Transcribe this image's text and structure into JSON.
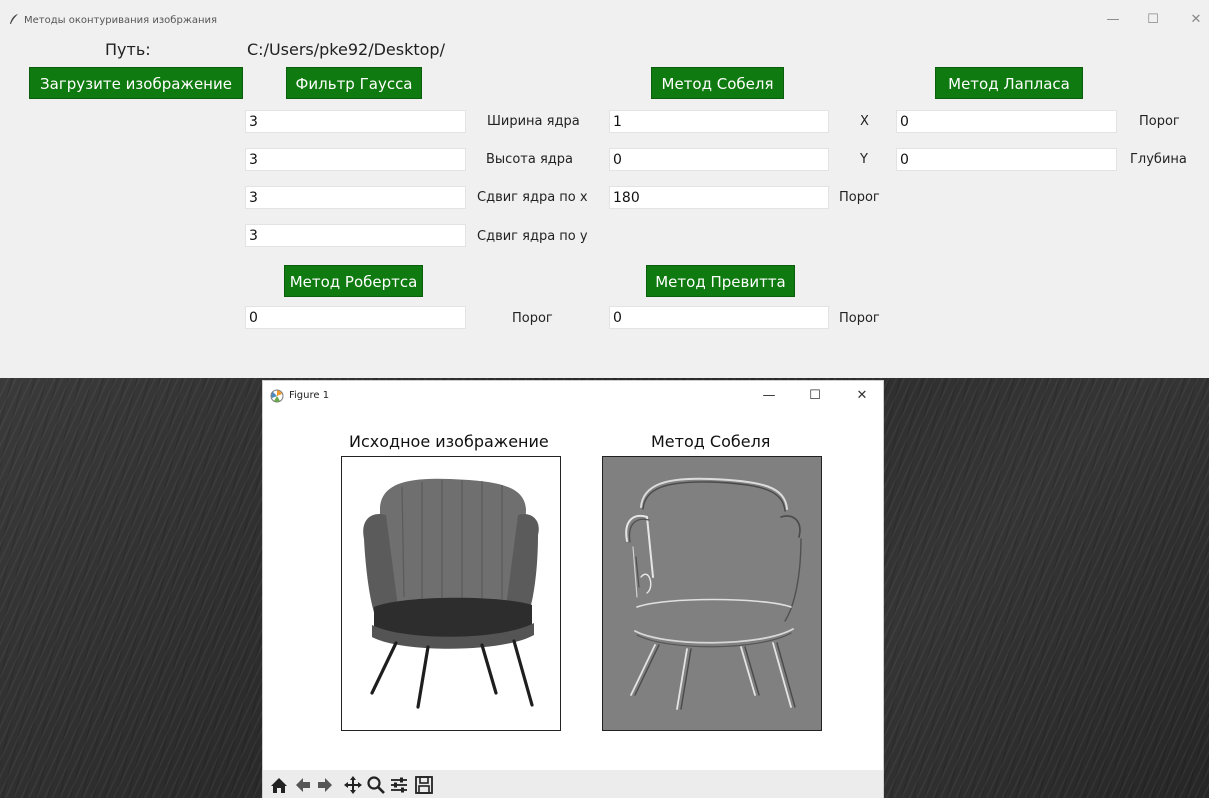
{
  "window": {
    "title": "Методы оконтуривания изобржания",
    "minimize": "—",
    "maximize": "☐",
    "close": "✕"
  },
  "path": {
    "label": "Путь:",
    "value": "C:/Users/pke92/Desktop/"
  },
  "buttons": {
    "load": "Загрузите изображение",
    "gauss": "Фильтр Гаусса",
    "sobel": "Метод Собеля",
    "laplace": "Метод Лапласа",
    "roberts": "Метод Робертса",
    "prewitt": "Метод Превитта"
  },
  "gauss": {
    "width_value": "3",
    "width_label": "Ширина ядра",
    "height_value": "3",
    "height_label": "Высота ядра",
    "shift_x_value": "3",
    "shift_x_label": "Сдвиг ядра по х",
    "shift_y_value": "3",
    "shift_y_label": "Сдвиг ядра по у"
  },
  "sobel": {
    "x_value": "1",
    "x_label": "X",
    "y_value": "0",
    "y_label": "Y",
    "threshold_value": "180",
    "threshold_label": "Порог"
  },
  "laplace": {
    "threshold_value": "0",
    "threshold_label": "Порог",
    "depth_value": "0",
    "depth_label": "Глубина"
  },
  "roberts": {
    "threshold_value": "0",
    "threshold_label": "Порог"
  },
  "prewitt": {
    "threshold_value": "0",
    "threshold_label": "Порог"
  },
  "figure": {
    "title": "Figure 1",
    "minimize": "—",
    "maximize": "☐",
    "close": "✕",
    "left_title": "Исходное изображение",
    "right_title": "Метод Собеля"
  },
  "toolbar": {
    "icons": [
      "home-icon",
      "back-arrow-icon",
      "forward-arrow-icon",
      "pan-icon",
      "zoom-icon",
      "configure-subplots-icon",
      "save-icon"
    ]
  },
  "colors": {
    "button_green": "#0f7a0f",
    "sobel_gray": "#808080"
  }
}
